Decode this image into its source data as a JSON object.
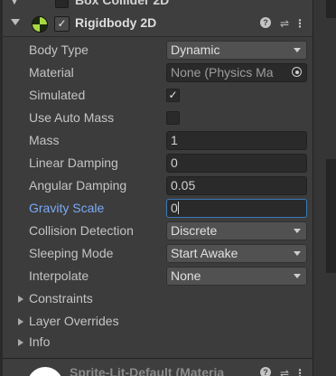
{
  "previous_component": {
    "title": "Box Collider 2D"
  },
  "component": {
    "title": "Rigidbody 2D",
    "enabled": true,
    "icon": "rigidbody2d-icon",
    "header_icons": [
      "help-icon",
      "preset-icon",
      "kebab-menu-icon"
    ],
    "checkmark_glyph": "✓"
  },
  "properties": {
    "body_type": {
      "label": "Body Type",
      "value": "Dynamic"
    },
    "material": {
      "label": "Material",
      "value": "None (Physics Ma"
    },
    "simulated": {
      "label": "Simulated",
      "checked": true
    },
    "use_auto_mass": {
      "label": "Use Auto Mass",
      "checked": false
    },
    "mass": {
      "label": "Mass",
      "value": "1"
    },
    "linear_damping": {
      "label": "Linear Damping",
      "value": "0"
    },
    "angular_damping": {
      "label": "Angular Damping",
      "value": "0.05"
    },
    "gravity_scale": {
      "label": "Gravity Scale",
      "value": "0"
    },
    "collision_detection": {
      "label": "Collision Detection",
      "value": "Discrete"
    },
    "sleeping_mode": {
      "label": "Sleeping Mode",
      "value": "Start Awake"
    },
    "interpolate": {
      "label": "Interpolate",
      "value": "None"
    }
  },
  "foldouts": {
    "constraints": "Constraints",
    "layer_overrides": "Layer Overrides",
    "info": "Info"
  },
  "next_component": {
    "title": "Sprite-Lit-Default (Materia"
  },
  "colors": {
    "panel_bg": "#3c3c3c",
    "field_bg": "#2a2a2a",
    "dropdown_bg": "#515151",
    "label_text": "#c4c4c4",
    "active_label": "#7baaf7",
    "focus_border": "#3a79bb"
  }
}
